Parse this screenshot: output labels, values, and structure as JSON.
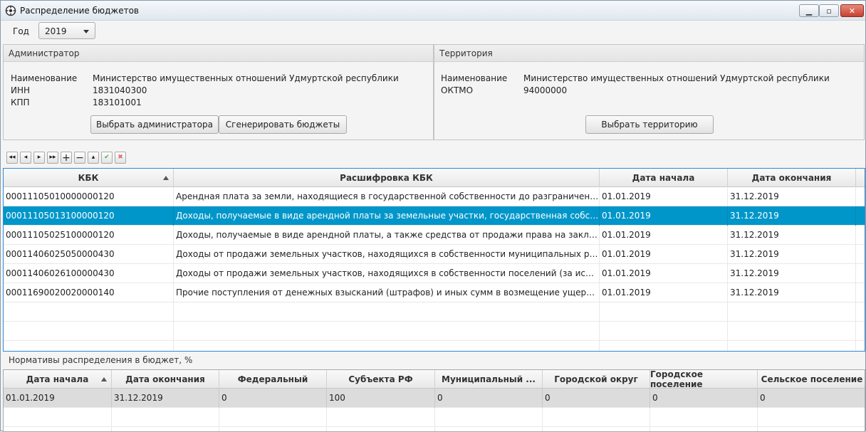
{
  "window": {
    "title": "Распределение бюджетов"
  },
  "year": {
    "label": "Год",
    "value": "2019"
  },
  "admin": {
    "header": "Администратор",
    "name_label": "Наименование",
    "name_value": "Министерство имущественных отношений Удмуртской республики",
    "inn_label": "ИНН",
    "inn_value": "1831040300",
    "kpp_label": "КПП",
    "kpp_value": "183101001",
    "select_btn": "Выбрать администратора",
    "generate_btn": "Сгенерировать бюджеты"
  },
  "territory": {
    "header": "Территория",
    "name_label": "Наименование",
    "name_value": "Министерство имущественных отношений Удмуртской республики",
    "oktmo_label": "ОКТМО",
    "oktmo_value": "94000000",
    "select_btn": "Выбрать территорию"
  },
  "toolbar": {
    "buttons": [
      "first-icon",
      "prev-icon",
      "next-icon",
      "last-icon",
      "add-icon",
      "remove-icon",
      "up-icon",
      "apply-icon",
      "cancel-icon"
    ]
  },
  "kbk_table": {
    "columns": [
      "КБК",
      "Расшифровка КБК",
      "Дата начала",
      "Дата окончания"
    ],
    "rows": [
      [
        "00011105010000000120",
        "Арендная плата за земли, находящиеся в государственной собственности до разграничения государственной собственности",
        "01.01.2019",
        "31.12.2019"
      ],
      [
        "00011105013100000120",
        "Доходы, получаемые в виде арендной платы за земельные участки, государственная собственность на которые не разграничена",
        "01.01.2019",
        "31.12.2019"
      ],
      [
        "00011105025100000120",
        "Доходы, получаемые в виде арендной платы, а также средства от продажи права на заключение договоров аренды",
        "01.01.2019",
        "31.12.2019"
      ],
      [
        "00011406025050000430",
        "Доходы от продажи земельных участков, находящихся в собственности муниципальных районов (за исключением",
        "01.01.2019",
        "31.12.2019"
      ],
      [
        "00011406026100000430",
        "Доходы от продажи земельных участков, находящихся в собственности поселений (за исключением земельных",
        "01.01.2019",
        "31.12.2019"
      ],
      [
        "00011690020020000140",
        "Прочие поступления от денежных взысканий (штрафов) и иных сумм в возмещение ущерба, зачисляемые",
        "01.01.2019",
        "31.12.2019"
      ]
    ]
  },
  "norms": {
    "label": "Нормативы распределения в бюджет, %",
    "columns": [
      "Дата начала",
      "Дата окончания",
      "Федеральный",
      "Субъекта РФ",
      "Муниципальный ...",
      "Городской округ",
      "Городское поселение",
      "Сельское поселение"
    ],
    "rows": [
      [
        "01.01.2019",
        "31.12.2019",
        "0",
        "100",
        "0",
        "0",
        "0",
        "0"
      ]
    ]
  }
}
